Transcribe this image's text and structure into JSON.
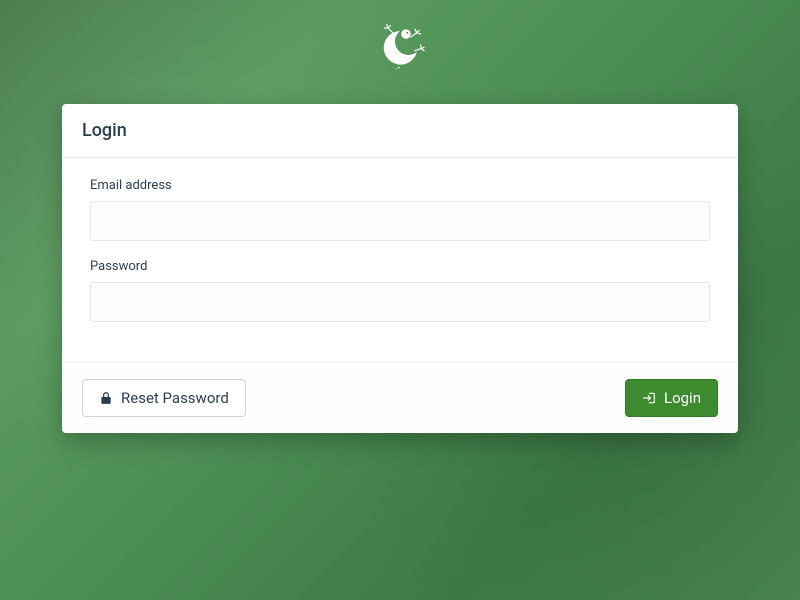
{
  "card": {
    "title": "Login"
  },
  "form": {
    "email_label": "Email address",
    "email_value": "",
    "password_label": "Password",
    "password_value": ""
  },
  "buttons": {
    "reset_label": "Reset Password",
    "login_label": "Login"
  },
  "colors": {
    "accent": "#3d8b2f",
    "text": "#2c3e50"
  }
}
